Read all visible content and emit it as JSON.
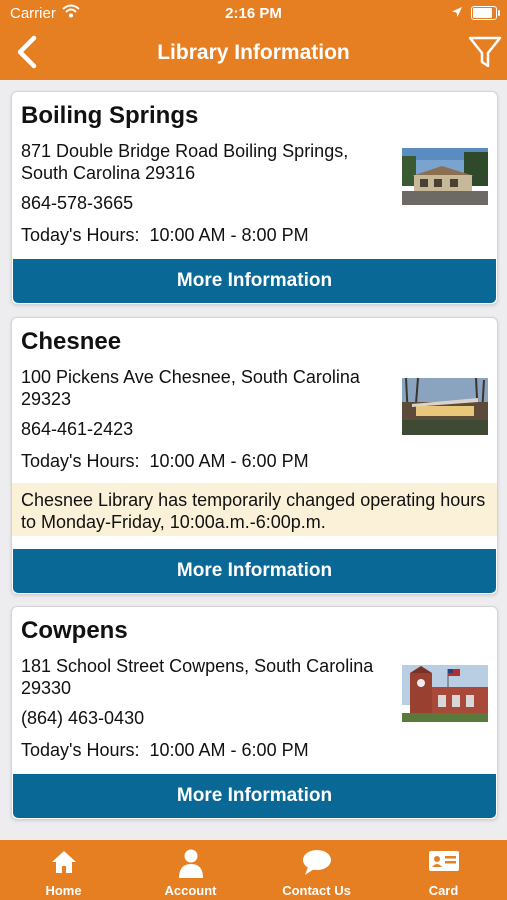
{
  "status_bar": {
    "carrier": "Carrier",
    "time": "2:16 PM"
  },
  "header": {
    "title": "Library Information"
  },
  "libraries": [
    {
      "name": "Boiling Springs",
      "address": "871 Double Bridge Road Boiling Springs, South Carolina 29316",
      "phone": "864-578-3665",
      "hours_label": "Today's Hours:",
      "hours": "10:00 AM - 8:00 PM",
      "notice": "",
      "button": "More Information"
    },
    {
      "name": "Chesnee",
      "address": "100 Pickens Ave Chesnee, South Carolina 29323",
      "phone": "864-461-2423",
      "hours_label": "Today's Hours:",
      "hours": "10:00 AM - 6:00 PM",
      "notice": "Chesnee Library has temporarily changed operating hours to Monday-Friday, 10:00a.m.-6:00p.m.",
      "button": "More Information"
    },
    {
      "name": "Cowpens",
      "address": "181 School Street Cowpens, South Carolina 29330",
      "phone": "(864) 463-0430",
      "hours_label": "Today's Hours:",
      "hours": "10:00 AM - 6:00 PM",
      "notice": "",
      "button": "More Information"
    }
  ],
  "tabs": [
    {
      "label": "Home",
      "icon": "home-icon"
    },
    {
      "label": "Account",
      "icon": "account-icon"
    },
    {
      "label": "Contact Us",
      "icon": "chat-icon"
    },
    {
      "label": "Card",
      "icon": "card-icon"
    }
  ],
  "colors": {
    "brand_orange": "#e67e22",
    "button_blue": "#0a6896",
    "notice_bg": "#fbf1d8"
  }
}
